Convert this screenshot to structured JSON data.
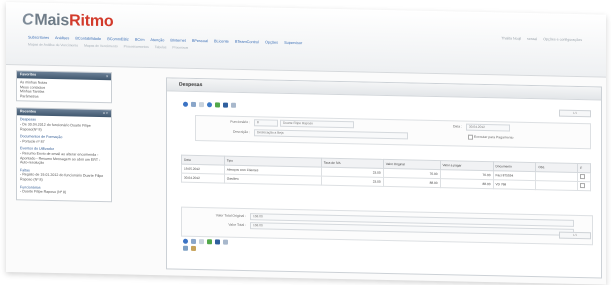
{
  "header": {
    "logo_prefix": "Mais",
    "logo_suffix": "Ritmo",
    "top_links": [
      "Thalita Ncqil",
      "sessal",
      "Opções e configurações"
    ],
    "menu": [
      "Subscritores",
      "Análises",
      "BContabilidade",
      "BCommEBiz",
      "BCrm",
      "Atenção",
      "BInternet",
      "BPessoal",
      "BLicente",
      "BTeamControl",
      "Opções",
      "Supervisor"
    ],
    "submenu": [
      "Mapas de Análise de Vencimento",
      "Mapas de Vencimento",
      "Processamentos",
      "Tabelas",
      "Processos"
    ]
  },
  "favorites": {
    "title": "Favoritos",
    "close": "x",
    "items": [
      "As minhas Notas",
      "Meus contactos",
      "Minhas Tarefas",
      "Parâmetros"
    ]
  },
  "recents": {
    "title": "Recentes",
    "controls": "x  >",
    "items": [
      {
        "title": "Despesas",
        "detail": "- De 30.04.2012 do funcionário Duarte Filipe Raposo(Nº 8)"
      },
      {
        "title": "Documentos de Formação",
        "detail": "- Portucle nº 87"
      },
      {
        "title": "Eventos do Utilizador",
        "detail": "- Resumo Envio de email ao alterar encomenda - Apontado - Resumo Mensagem ao abrir um ERT - Auto-resolução"
      },
      {
        "title": "Faltas",
        "detail": "- Registo de 19.01.2012 do funcionário Duarte Filipe Raposo (Nº 8)"
      },
      {
        "title": "Funcionários",
        "detail": "- Duarte Filipe Raposo (Nº 8)"
      }
    ]
  },
  "main": {
    "title": "Despesas",
    "pager": "1/1",
    "form": {
      "funcionario_label": "Funcionário :",
      "funcionario_code": "8",
      "funcionario_name": "Duarte Filipe Raposo",
      "descricao_label": "Descrição :",
      "descricao_value": "Deslocação a Beja",
      "data_label": "Data :",
      "data_value": "30.04.2012",
      "pagamento_label": "Executar para Pagamento"
    },
    "table": {
      "columns": [
        "Data",
        "Tipo",
        "Taxa de IVA",
        "Valor Original",
        "Valor a pagar",
        "Documento",
        "Obs.",
        "F"
      ],
      "rows": [
        [
          "19.05.2012",
          "Almoços com Clientes",
          "23.00",
          "70.00",
          "70.00",
          "Fact 875594",
          "",
          ""
        ],
        [
          "30.04.2012",
          "Gasóleo",
          "23.00",
          "88.00",
          "88.00",
          "VD 768",
          "",
          ""
        ]
      ]
    },
    "totals": {
      "original_label": "Valor Total Original :",
      "original_value": "158.00",
      "total_label": "Valor Total :",
      "total_value": "158.00"
    }
  },
  "colors": {
    "logo_red": "#d23a2b",
    "panel_header": "#4e647b",
    "link_blue": "#3b6fb6"
  }
}
